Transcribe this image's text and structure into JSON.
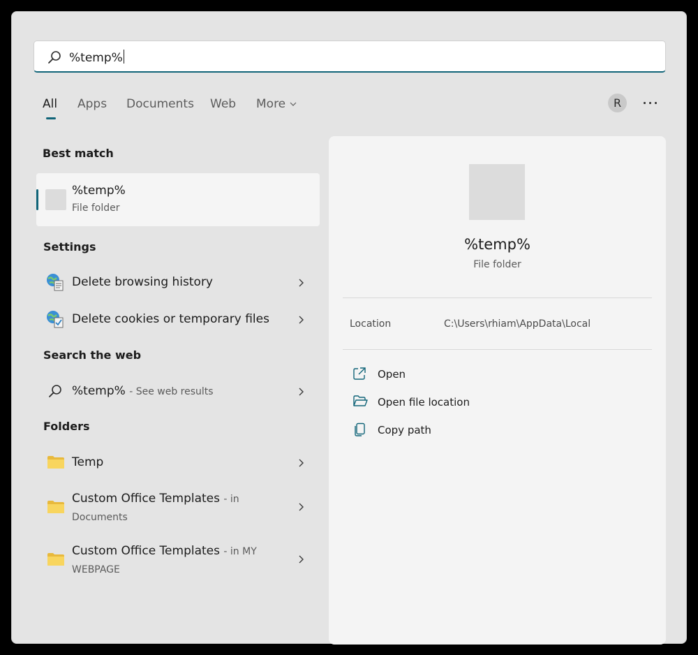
{
  "search": {
    "value": "%temp%",
    "icon": "search-icon"
  },
  "tabs": [
    {
      "label": "All",
      "active": true
    },
    {
      "label": "Apps"
    },
    {
      "label": "Documents"
    },
    {
      "label": "Web"
    },
    {
      "label": "More"
    }
  ],
  "avatar_letter": "R",
  "accent_color": "#106478",
  "best_match": {
    "heading": "Best match",
    "title": "%temp%",
    "subtitle": "File folder"
  },
  "settings": {
    "heading": "Settings",
    "items": [
      {
        "label": "Delete browsing history",
        "icon": "internet-options-icon"
      },
      {
        "label": "Delete cookies or temporary files",
        "icon": "internet-options-icon"
      }
    ]
  },
  "web": {
    "heading": "Search the web",
    "query": "%temp%",
    "suffix": "- See web results"
  },
  "folders": {
    "heading": "Folders",
    "items": [
      {
        "label": "Temp",
        "suffix": ""
      },
      {
        "label": "Custom Office Templates",
        "suffix": "- in",
        "line2": "Documents"
      },
      {
        "label": "Custom Office Templates",
        "suffix": "- in MY",
        "line2": "WEBPAGE"
      }
    ]
  },
  "preview": {
    "title": "%temp%",
    "subtitle": "File folder",
    "location_label": "Location",
    "location_value": "C:\\Users\\rhiam\\AppData\\Local",
    "actions": [
      {
        "label": "Open",
        "icon": "open-external-icon"
      },
      {
        "label": "Open file location",
        "icon": "folder-open-icon"
      },
      {
        "label": "Copy path",
        "icon": "copy-icon"
      }
    ]
  }
}
